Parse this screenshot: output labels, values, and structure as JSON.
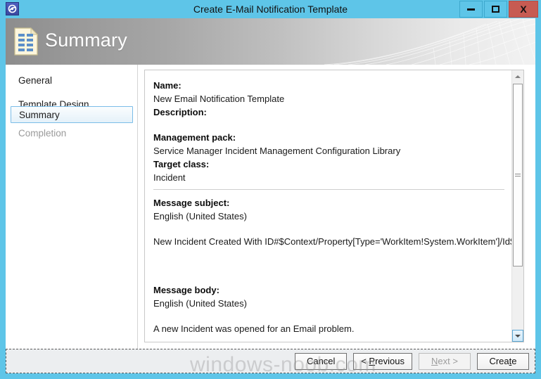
{
  "window": {
    "title": "Create E-Mail Notification Template",
    "icon": "app-notification-icon",
    "controls": {
      "minimize": "minimize-icon",
      "maximize": "maximize-icon",
      "close": "X"
    }
  },
  "banner": {
    "title": "Summary",
    "icon": "summary-document-icon"
  },
  "sidebar": {
    "items": [
      {
        "label": "General",
        "state": "normal"
      },
      {
        "label": "Template Design",
        "state": "normal"
      },
      {
        "label": "Summary",
        "state": "selected"
      },
      {
        "label": "Completion",
        "state": "disabled"
      }
    ]
  },
  "content": {
    "name_label": "Name:",
    "name_value": "New Email Notification Template",
    "description_label": "Description:",
    "description_value": "",
    "management_pack_label": "Management pack:",
    "management_pack_value": "Service Manager Incident Management Configuration Library",
    "target_class_label": "Target class:",
    "target_class_value": "Incident",
    "message_subject_label": "Message subject:",
    "message_subject_language": "English (United States)",
    "message_subject_value": "New Incident Created With ID#$Context/Property[Type='WorkItem!System.WorkItem']/Id$",
    "message_body_label": "Message body:",
    "message_body_language": "English (United States)",
    "message_body_value": "A new Incident was opened for an Email problem."
  },
  "scrollbar": {
    "up_arrow": "scroll-up-icon",
    "down_arrow": "scroll-down-icon"
  },
  "footer": {
    "buttons": [
      {
        "label": "Cancel",
        "mnemonic": "",
        "state": "enabled",
        "name": "cancel-button"
      },
      {
        "label": "< Previous",
        "mnemonic": "P",
        "state": "enabled",
        "name": "previous-button"
      },
      {
        "label": "Next >",
        "mnemonic": "N",
        "state": "disabled",
        "name": "next-button"
      },
      {
        "label": "Create",
        "mnemonic": "t",
        "state": "enabled",
        "name": "create-button"
      }
    ]
  },
  "watermark": {
    "text": "windows-noob.com"
  },
  "colors": {
    "titlebar": "#5ec5e8",
    "close_button": "#c75b52",
    "selection_border": "#7bbde8",
    "footer_background": "#eceef0"
  }
}
